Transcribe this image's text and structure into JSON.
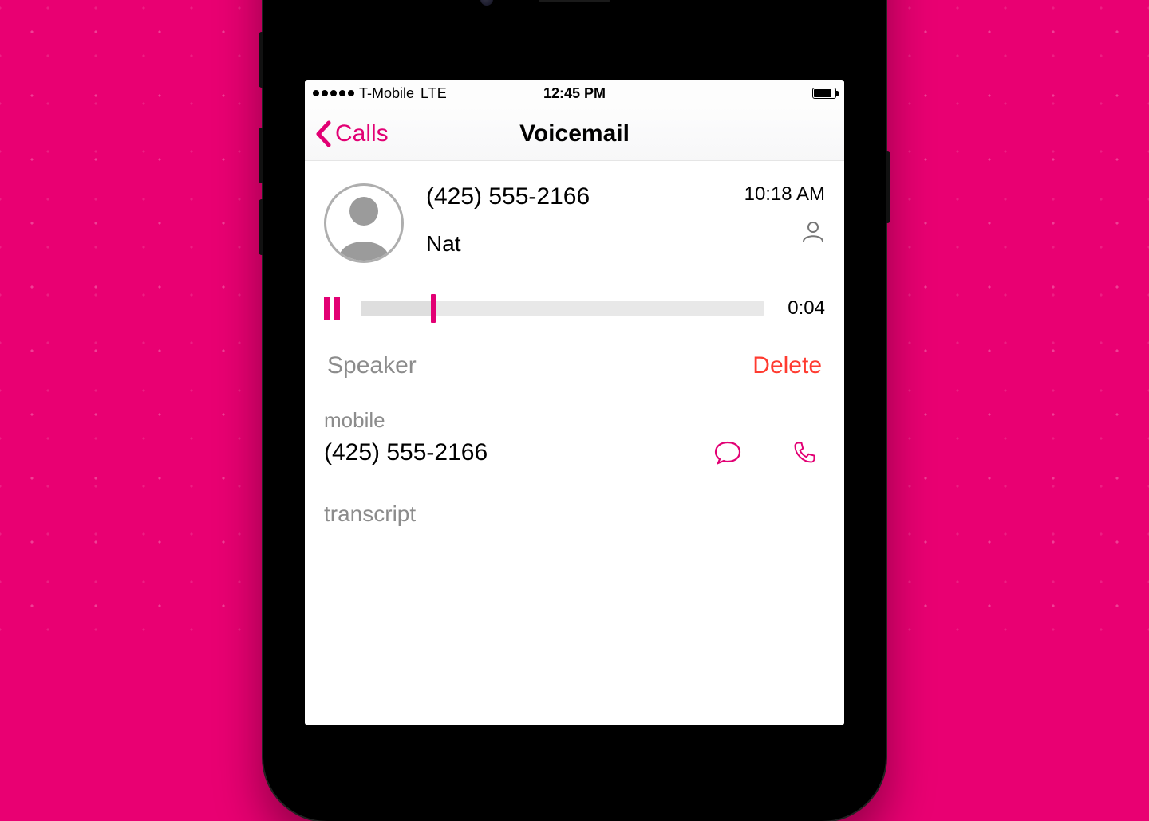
{
  "status": {
    "carrier": "T-Mobile",
    "network": "LTE",
    "time": "12:45 PM"
  },
  "nav": {
    "back_label": "Calls",
    "title": "Voicemail"
  },
  "voicemail": {
    "number": "(425) 555-2166",
    "name": "Nat",
    "time": "10:18 AM",
    "elapsed": "0:04",
    "progress_percent": 18
  },
  "actions": {
    "speaker": "Speaker",
    "delete": "Delete"
  },
  "contact": {
    "label": "mobile",
    "number": "(425) 555-2166"
  },
  "transcript": {
    "label": "transcript"
  },
  "colors": {
    "accent": "#e20074",
    "delete": "#ff3b30",
    "muted": "#8c8c8c"
  }
}
